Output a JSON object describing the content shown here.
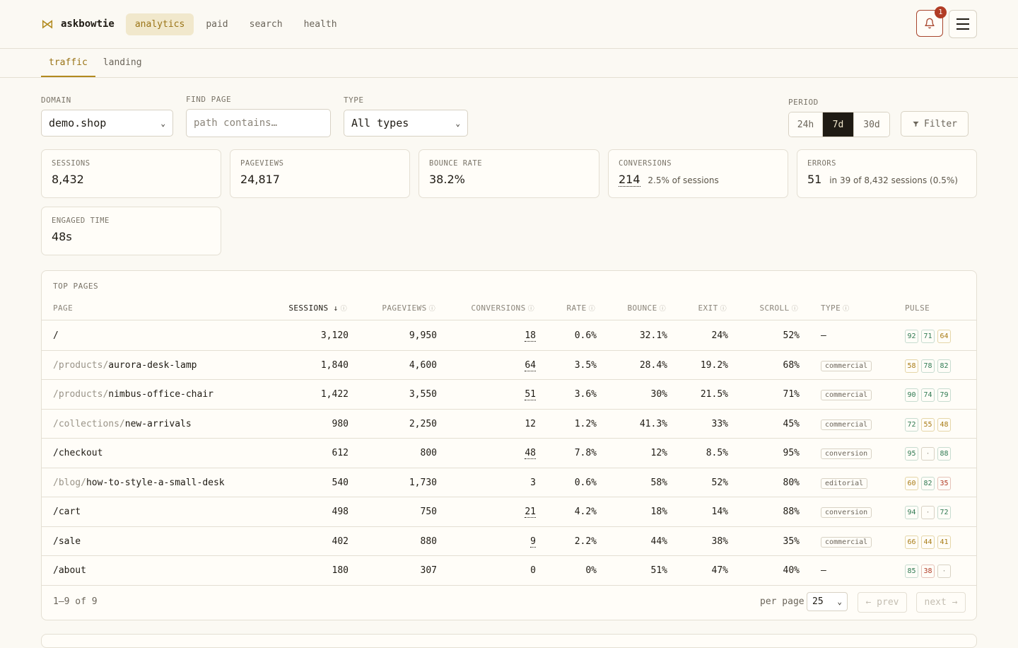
{
  "brand": {
    "name": "askbowtie",
    "icon": "bowtie-icon"
  },
  "nav": [
    {
      "label": "analytics",
      "active": true
    },
    {
      "label": "paid",
      "active": false
    },
    {
      "label": "search",
      "active": false
    },
    {
      "label": "health",
      "active": false
    }
  ],
  "notifications": {
    "count": "1"
  },
  "subtabs": [
    {
      "label": "traffic",
      "active": true
    },
    {
      "label": "landing",
      "active": false
    }
  ],
  "filters": {
    "domain_label": "DOMAIN",
    "domain_value": "demo.shop",
    "find_label": "FIND PAGE",
    "find_placeholder": "path contains…",
    "type_label": "TYPE",
    "type_value": "All types",
    "period_label": "PERIOD",
    "periods": [
      "24h",
      "7d",
      "30d"
    ],
    "active_period": "7d",
    "filter_button": "Filter"
  },
  "cards": {
    "sessions": {
      "label": "SESSIONS",
      "value": "8,432"
    },
    "pageviews": {
      "label": "PAGEVIEWS",
      "value": "24,817"
    },
    "bounce": {
      "label": "BOUNCE RATE",
      "value": "38.2%"
    },
    "conversions": {
      "label": "CONVERSIONS",
      "value": "214",
      "sub": "2.5% of sessions"
    },
    "errors": {
      "label": "ERRORS",
      "value": "51",
      "sub": "in 39 of 8,432 sessions (0.5%)"
    },
    "engaged": {
      "label": "ENGAGED TIME",
      "value": "48s"
    }
  },
  "table": {
    "title": "TOP PAGES",
    "columns": {
      "page": "PAGE",
      "sessions": "SESSIONS ↓",
      "pageviews": "PAGEVIEWS",
      "conversions": "CONVERSIONS",
      "rate": "RATE",
      "bounce": "BOUNCE",
      "exit": "EXIT",
      "scroll": "SCROLL",
      "type": "TYPE",
      "pulse": "PULSE"
    },
    "rows": [
      {
        "prefix": "",
        "path": "/",
        "sessions": "3,120",
        "pageviews": "9,950",
        "conversions": "18",
        "conv_link": true,
        "rate": "0.6%",
        "bounce": "32.1%",
        "exit": "24%",
        "scroll": "52%",
        "type": "—",
        "pulse": [
          {
            "v": "92",
            "s": "good"
          },
          {
            "v": "71",
            "s": "good"
          },
          {
            "v": "64",
            "s": "mid"
          }
        ]
      },
      {
        "prefix": "/products/",
        "path": "aurora-desk-lamp",
        "sessions": "1,840",
        "pageviews": "4,600",
        "conversions": "64",
        "conv_link": true,
        "rate": "3.5%",
        "bounce": "28.4%",
        "exit": "19.2%",
        "scroll": "68%",
        "type": "commercial",
        "pulse": [
          {
            "v": "58",
            "s": "mid"
          },
          {
            "v": "78",
            "s": "good"
          },
          {
            "v": "82",
            "s": "good"
          }
        ]
      },
      {
        "prefix": "/products/",
        "path": "nimbus-office-chair",
        "sessions": "1,422",
        "pageviews": "3,550",
        "conversions": "51",
        "conv_link": true,
        "rate": "3.6%",
        "bounce": "30%",
        "exit": "21.5%",
        "scroll": "71%",
        "type": "commercial",
        "pulse": [
          {
            "v": "90",
            "s": "good"
          },
          {
            "v": "74",
            "s": "good"
          },
          {
            "v": "79",
            "s": "good"
          }
        ]
      },
      {
        "prefix": "/collections/",
        "path": "new-arrivals",
        "sessions": "980",
        "pageviews": "2,250",
        "conversions": "12",
        "conv_link": false,
        "rate": "1.2%",
        "bounce": "41.3%",
        "exit": "33%",
        "scroll": "45%",
        "type": "commercial",
        "pulse": [
          {
            "v": "72",
            "s": "good"
          },
          {
            "v": "55",
            "s": "mid"
          },
          {
            "v": "48",
            "s": "mid"
          }
        ]
      },
      {
        "prefix": "",
        "path": "/checkout",
        "sessions": "612",
        "pageviews": "800",
        "conversions": "48",
        "conv_link": true,
        "rate": "7.8%",
        "bounce": "12%",
        "exit": "8.5%",
        "scroll": "95%",
        "type": "conversion",
        "pulse": [
          {
            "v": "95",
            "s": "good"
          },
          {
            "v": "·",
            "s": "none"
          },
          {
            "v": "88",
            "s": "good"
          }
        ]
      },
      {
        "prefix": "/blog/",
        "path": "how-to-style-a-small-desk",
        "sessions": "540",
        "pageviews": "1,730",
        "conversions": "3",
        "conv_link": false,
        "rate": "0.6%",
        "bounce": "58%",
        "exit": "52%",
        "scroll": "80%",
        "type": "editorial",
        "pulse": [
          {
            "v": "60",
            "s": "mid"
          },
          {
            "v": "82",
            "s": "good"
          },
          {
            "v": "35",
            "s": "bad"
          }
        ]
      },
      {
        "prefix": "",
        "path": "/cart",
        "sessions": "498",
        "pageviews": "750",
        "conversions": "21",
        "conv_link": true,
        "rate": "4.2%",
        "bounce": "18%",
        "exit": "14%",
        "scroll": "88%",
        "type": "conversion",
        "pulse": [
          {
            "v": "94",
            "s": "good"
          },
          {
            "v": "·",
            "s": "none"
          },
          {
            "v": "72",
            "s": "good"
          }
        ]
      },
      {
        "prefix": "",
        "path": "/sale",
        "sessions": "402",
        "pageviews": "880",
        "conversions": "9",
        "conv_link": true,
        "rate": "2.2%",
        "bounce": "44%",
        "exit": "38%",
        "scroll": "35%",
        "type": "commercial",
        "pulse": [
          {
            "v": "66",
            "s": "mid"
          },
          {
            "v": "44",
            "s": "mid"
          },
          {
            "v": "41",
            "s": "mid"
          }
        ]
      },
      {
        "prefix": "",
        "path": "/about",
        "sessions": "180",
        "pageviews": "307",
        "conversions": "0",
        "conv_link": false,
        "rate": "0%",
        "bounce": "51%",
        "exit": "47%",
        "scroll": "40%",
        "type": "—",
        "pulse": [
          {
            "v": "85",
            "s": "good"
          },
          {
            "v": "38",
            "s": "bad"
          },
          {
            "v": "·",
            "s": "none"
          }
        ]
      }
    ],
    "footer": {
      "range": "1–9 of 9",
      "per_page_label": "per page",
      "per_page_value": "25",
      "prev": "← prev",
      "next": "next →"
    }
  }
}
